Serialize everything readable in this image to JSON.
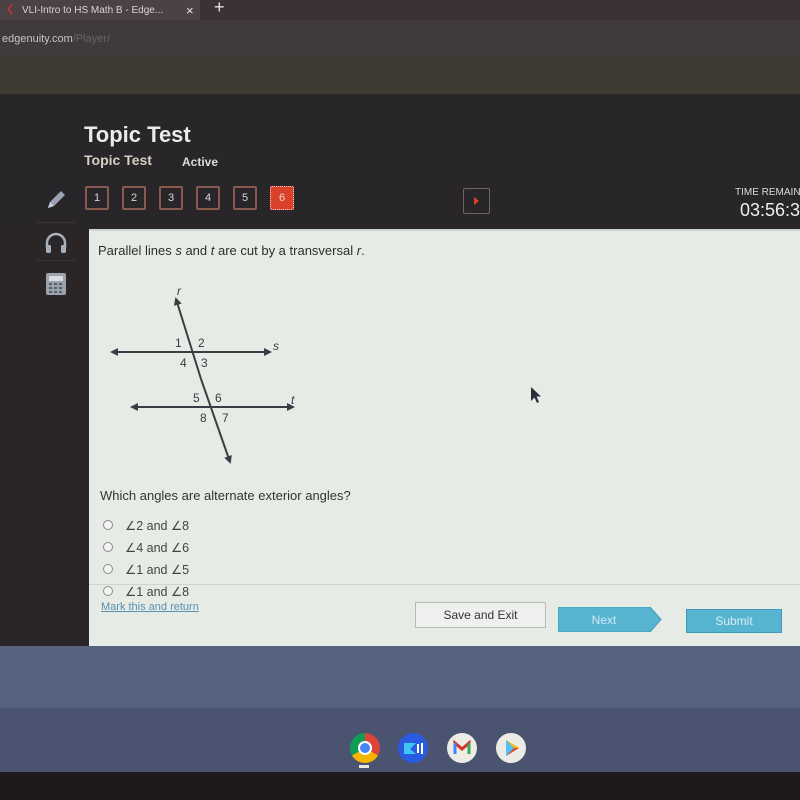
{
  "browser": {
    "tab_title": "VLI-Intro to HS Math B - Edge...",
    "url_domain": "edgenuity.com",
    "url_path": "/Player/"
  },
  "header": {
    "title": "Topic Test",
    "subtitle": "Topic Test",
    "status": "Active"
  },
  "question_nav": {
    "items": [
      "1",
      "2",
      "3",
      "4",
      "5",
      "6"
    ],
    "active": "6"
  },
  "timer": {
    "label": "TIME REMAIN",
    "value": "03:56:3"
  },
  "tools": {
    "items": [
      "pencil-icon",
      "headphones-icon",
      "calculator-icon"
    ]
  },
  "content": {
    "prompt_pre": "Parallel lines ",
    "prompt_s": "s",
    "prompt_and": " and ",
    "prompt_t": "t",
    "prompt_mid": " are cut by a transversal ",
    "prompt_r": "r",
    "prompt_end": ".",
    "diagram": {
      "line_labels": {
        "transversal": "r",
        "top": "s",
        "bottom": "t"
      },
      "angles": [
        "1",
        "2",
        "3",
        "4",
        "5",
        "6",
        "7",
        "8"
      ]
    },
    "question": "Which angles are alternate exterior angles?",
    "options": [
      "∠2 and ∠8",
      "∠4 and ∠6",
      "∠1 and ∠5",
      "∠1 and ∠8"
    ]
  },
  "footer": {
    "mark_link": "Mark this and return",
    "save_exit": "Save and Exit",
    "next": "Next",
    "submit": "Submit"
  },
  "shelf": {
    "apps": [
      "chrome",
      "screencastify",
      "gmail",
      "play-store"
    ]
  },
  "colors": {
    "active_question": "#d9412c",
    "button_blue": "#56b4d0",
    "link": "#5a8fb0"
  }
}
